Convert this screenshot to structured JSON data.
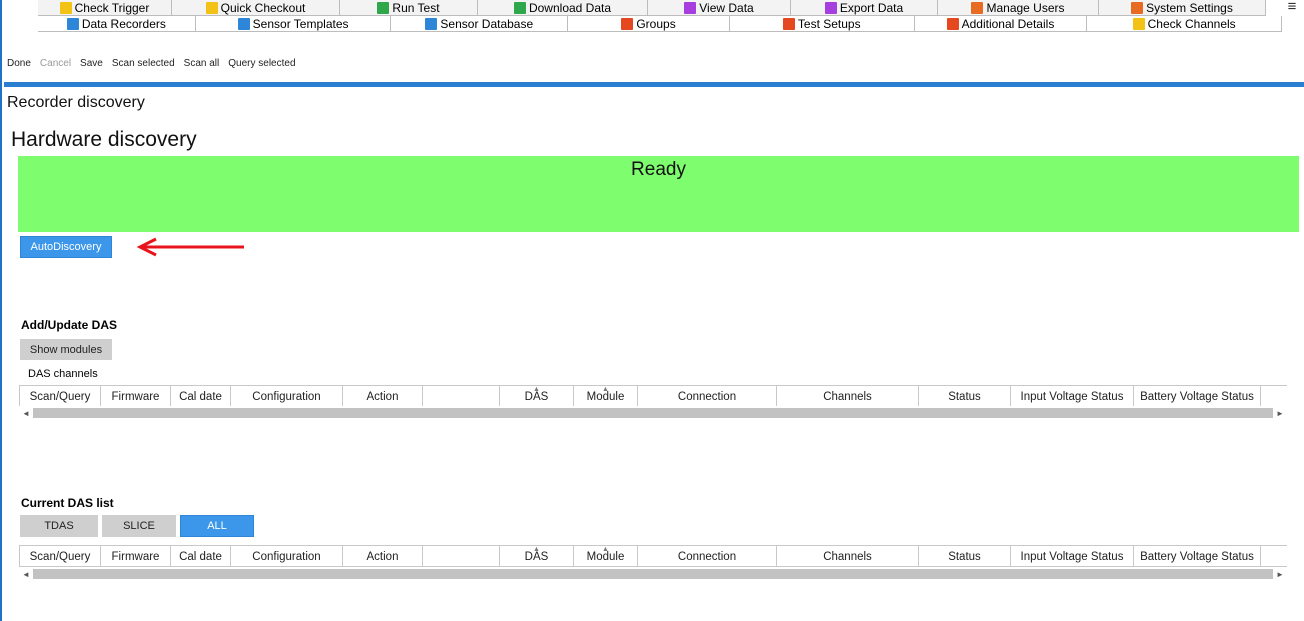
{
  "tabs_row1": [
    {
      "label": "Check Trigger",
      "icon": "check-trigger-icon",
      "color": "#f2c316"
    },
    {
      "label": "Quick Checkout",
      "icon": "quick-checkout-icon",
      "color": "#f2c316"
    },
    {
      "label": "Run Test",
      "icon": "run-test-icon",
      "color": "#2ea84a"
    },
    {
      "label": "Download Data",
      "icon": "download-data-icon",
      "color": "#2ea84a"
    },
    {
      "label": "View Data",
      "icon": "view-data-icon",
      "color": "#a63ee0"
    },
    {
      "label": "Export Data",
      "icon": "export-data-icon",
      "color": "#a63ee0"
    },
    {
      "label": "Manage Users",
      "icon": "manage-users-icon",
      "color": "#e76b22"
    },
    {
      "label": "System Settings",
      "icon": "system-settings-icon",
      "color": "#e76b22"
    }
  ],
  "tabs_row2": [
    {
      "label": "Data Recorders",
      "icon": "data-recorders-icon",
      "color": "#2d86d8"
    },
    {
      "label": "Sensor Templates",
      "icon": "sensor-templates-icon",
      "color": "#2d86d8"
    },
    {
      "label": "Sensor Database",
      "icon": "sensor-database-icon",
      "color": "#2d86d8"
    },
    {
      "label": "Groups",
      "icon": "groups-icon",
      "color": "#e5471f"
    },
    {
      "label": "Test Setups",
      "icon": "test-setups-icon",
      "color": "#e5471f"
    },
    {
      "label": "Additional Details",
      "icon": "additional-details-icon",
      "color": "#e5471f"
    },
    {
      "label": "Check Channels",
      "icon": "check-channels-icon",
      "color": "#f2c316"
    }
  ],
  "menu_glyph": "≡",
  "toolbar": {
    "done": "Done",
    "cancel": "Cancel",
    "save": "Save",
    "scan_selected": "Scan selected",
    "scan_all": "Scan all",
    "query_selected": "Query selected"
  },
  "page": {
    "recorder_discovery": "Recorder discovery",
    "hardware_discovery": "Hardware discovery",
    "status": "Ready",
    "status_color": "#7efd6f",
    "autodiscovery": "AutoDiscovery"
  },
  "add_update": {
    "title": "Add/Update DAS",
    "show_modules": "Show modules",
    "channels_label": "DAS channels"
  },
  "current_list": {
    "title": "Current DAS list",
    "filters": [
      "TDAS",
      "SLICE",
      "ALL"
    ],
    "active_filter": "ALL"
  },
  "columns": [
    "Scan/Query",
    "Firmware",
    "Cal date",
    "Configuration",
    "Action",
    "",
    "DAS",
    "Module",
    "Connection",
    "Channels",
    "Status",
    "Input Voltage Status",
    "Battery Voltage Status"
  ],
  "scroll": {
    "left": "◄",
    "right": "►"
  }
}
